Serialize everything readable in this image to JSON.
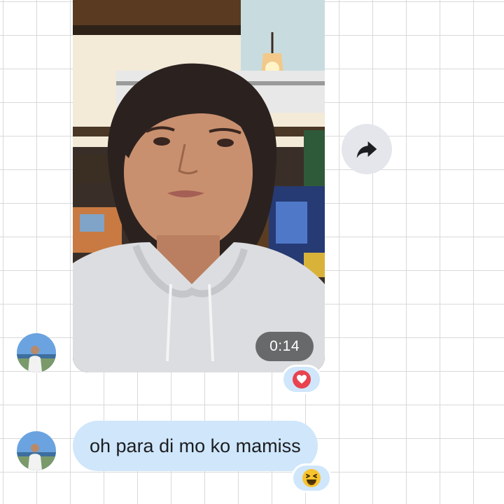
{
  "thread": {
    "video_message": {
      "duration": "0:14",
      "reaction_icon": "heart-icon",
      "reaction_color": "#e8434f"
    },
    "text_message": {
      "text": "oh para di mo ko mamiss",
      "reaction_icon": "laughing-face-icon"
    },
    "forward_button_icon": "share-arrow-icon",
    "bubble_color": "#cfe6fb",
    "avatar_icon": "user-avatar"
  }
}
